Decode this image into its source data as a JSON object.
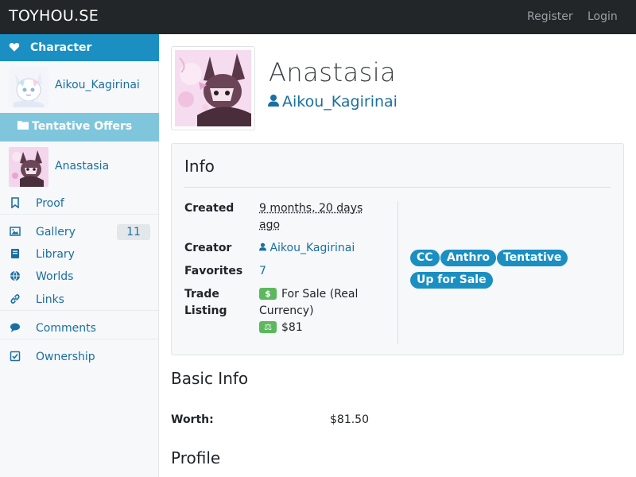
{
  "navbar": {
    "brand": "TOYHOU.SE",
    "register": "Register",
    "login": "Login"
  },
  "sidebar": {
    "header": "Character",
    "owner_name": "Aikou_Kagirinai",
    "folder": "Tentative Offers",
    "character_name": "Anastasia",
    "items": [
      {
        "label": "Proof",
        "icon": "bookmark-icon"
      },
      {
        "label": "Gallery",
        "icon": "image-icon",
        "count": "11"
      },
      {
        "label": "Library",
        "icon": "book-icon"
      },
      {
        "label": "Worlds",
        "icon": "globe-icon"
      },
      {
        "label": "Links",
        "icon": "link-icon"
      },
      {
        "label": "Comments",
        "icon": "comment-icon"
      },
      {
        "label": "Ownership",
        "icon": "check-square-icon"
      }
    ]
  },
  "profile": {
    "name": "Anastasia",
    "owner": "Aikou_Kagirinai"
  },
  "info": {
    "title": "Info",
    "created_label": "Created",
    "created_value_line1": "9 months, 20 days",
    "created_value_line2": "ago",
    "creator_label": "Creator",
    "creator_value": "Aikou_Kagirinai",
    "favorites_label": "Favorites",
    "favorites_value": "7",
    "trade_label_line1": "Trade",
    "trade_label_line2": "Listing",
    "trade_line1": "For Sale (Real",
    "trade_line2": "Currency)",
    "trade_price": "$81",
    "tags": [
      "CC",
      "Anthro",
      "Tentative",
      "Up for Sale"
    ]
  },
  "basic_info": {
    "title": "Basic Info",
    "worth_label": "Worth:",
    "worth_value": "$81.50"
  },
  "profile_section": {
    "title": "Profile"
  },
  "colors": {
    "navbar": "#222629",
    "accent": "#1b8fc1",
    "sub_accent": "#7fc6dd",
    "link": "#1b6fa0",
    "money": "#5cb85c"
  }
}
